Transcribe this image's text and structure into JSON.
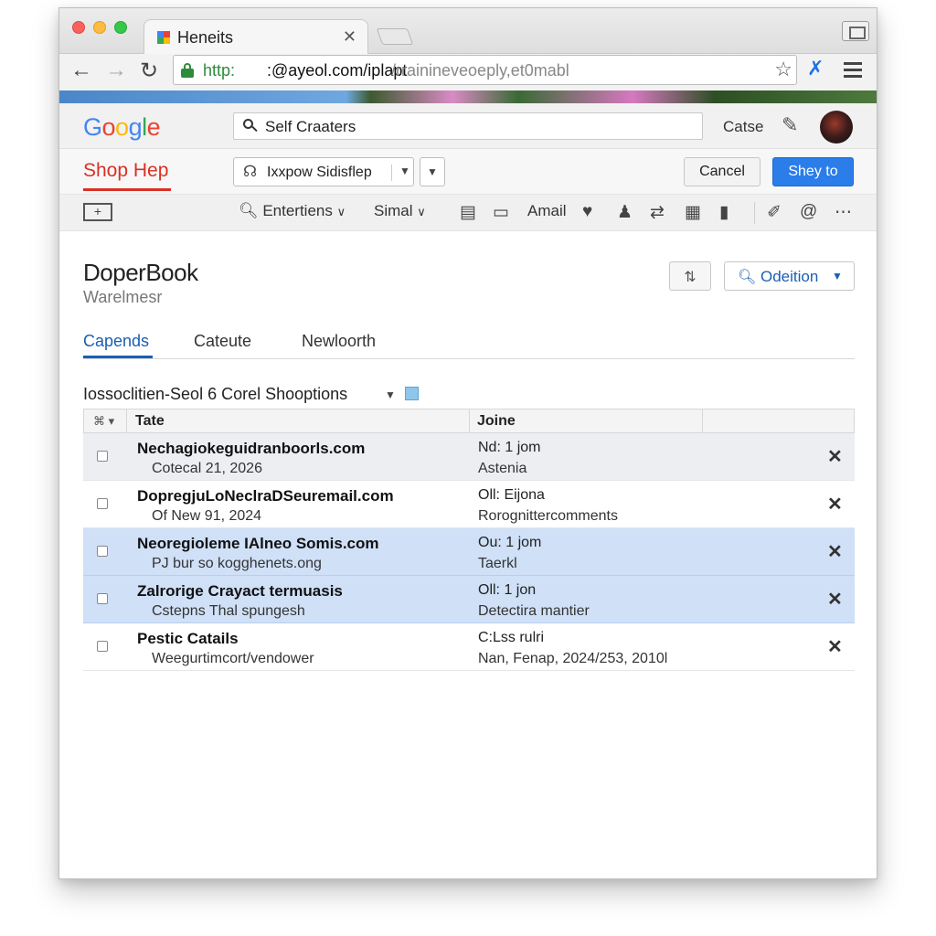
{
  "browser": {
    "tab_title": "Heneits",
    "url_scheme": "http:",
    "url_host": ":@ayeol.com/iplapt",
    "url_path": "/rrainineveoeply,et0mabl"
  },
  "google": {
    "logo_letters": [
      "G",
      "o",
      "o",
      "g",
      "l",
      "e"
    ],
    "logo_colors": [
      "#4285f4",
      "#ea4335",
      "#fbbc05",
      "#4285f4",
      "#34a853",
      "#ea4335"
    ],
    "search_text": "Self Craaters",
    "header_label": "Catse"
  },
  "app": {
    "title": "Shop Hep",
    "select_text": "Ixxpow Sidisflep",
    "cancel_label": "Cancel",
    "primary_label": "Shey to"
  },
  "toolbar": {
    "entertiens": "Entertiens",
    "simal": "Simal",
    "amail": "Amail"
  },
  "doc": {
    "title": "DoperBook",
    "subtitle": "Warelmesr",
    "option_label": "Odeition"
  },
  "tabs": [
    "Capends",
    "Cateute",
    "Newloorth"
  ],
  "section": {
    "title": "Iossoclitien-Seol 6 Corel Shooptions"
  },
  "table": {
    "columns": [
      "Tate",
      "Joine"
    ],
    "rows": [
      {
        "title": "Nechagiokeguidranboorls.com",
        "sub": "Cotecal 21, 2026",
        "join1": "Nd: 1 jom",
        "join2": "Astenia",
        "state": "hover"
      },
      {
        "title": "DopregjuLoNeclraDSeuremail.com",
        "sub": "Of New 91, 2024",
        "join1": "Oll: Eijona",
        "join2": "Rorognittercomments",
        "state": "normal"
      },
      {
        "title": "Neoregioleme IAlneo Somis.com",
        "sub": "PJ bur so kogghenets.ong",
        "join1": "Ou: 1 jom",
        "join2": "Taerkl",
        "state": "selected"
      },
      {
        "title": "Zalrorige Crayact termuasis",
        "sub": "Cstepns Thal spungesh",
        "join1": "Oll: 1 jon",
        "join2": "Detectira mantier",
        "state": "selected"
      },
      {
        "title": "Pestic Catails",
        "sub": "Weegurtimcort/vendower",
        "join1": "C:Lss rulri",
        "join2": "Nan, Fenap, 2024/253, 2010l",
        "state": "normal"
      }
    ]
  },
  "colors": {
    "accent_red": "#d93025",
    "accent_blue": "#1a5fb4",
    "primary_button": "#2b7de9",
    "row_selected": "#cfe0f7"
  }
}
